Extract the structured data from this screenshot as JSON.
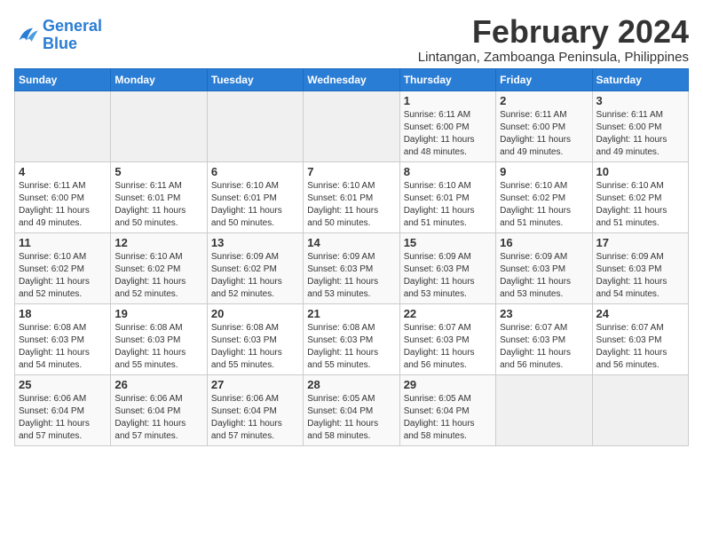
{
  "logo": {
    "text_general": "General",
    "text_blue": "Blue"
  },
  "title": {
    "month_year": "February 2024",
    "location": "Lintangan, Zamboanga Peninsula, Philippines"
  },
  "headers": [
    "Sunday",
    "Monday",
    "Tuesday",
    "Wednesday",
    "Thursday",
    "Friday",
    "Saturday"
  ],
  "weeks": [
    [
      {
        "num": "",
        "info": ""
      },
      {
        "num": "",
        "info": ""
      },
      {
        "num": "",
        "info": ""
      },
      {
        "num": "",
        "info": ""
      },
      {
        "num": "1",
        "info": "Sunrise: 6:11 AM\nSunset: 6:00 PM\nDaylight: 11 hours\nand 48 minutes."
      },
      {
        "num": "2",
        "info": "Sunrise: 6:11 AM\nSunset: 6:00 PM\nDaylight: 11 hours\nand 49 minutes."
      },
      {
        "num": "3",
        "info": "Sunrise: 6:11 AM\nSunset: 6:00 PM\nDaylight: 11 hours\nand 49 minutes."
      }
    ],
    [
      {
        "num": "4",
        "info": "Sunrise: 6:11 AM\nSunset: 6:00 PM\nDaylight: 11 hours\nand 49 minutes."
      },
      {
        "num": "5",
        "info": "Sunrise: 6:11 AM\nSunset: 6:01 PM\nDaylight: 11 hours\nand 50 minutes."
      },
      {
        "num": "6",
        "info": "Sunrise: 6:10 AM\nSunset: 6:01 PM\nDaylight: 11 hours\nand 50 minutes."
      },
      {
        "num": "7",
        "info": "Sunrise: 6:10 AM\nSunset: 6:01 PM\nDaylight: 11 hours\nand 50 minutes."
      },
      {
        "num": "8",
        "info": "Sunrise: 6:10 AM\nSunset: 6:01 PM\nDaylight: 11 hours\nand 51 minutes."
      },
      {
        "num": "9",
        "info": "Sunrise: 6:10 AM\nSunset: 6:02 PM\nDaylight: 11 hours\nand 51 minutes."
      },
      {
        "num": "10",
        "info": "Sunrise: 6:10 AM\nSunset: 6:02 PM\nDaylight: 11 hours\nand 51 minutes."
      }
    ],
    [
      {
        "num": "11",
        "info": "Sunrise: 6:10 AM\nSunset: 6:02 PM\nDaylight: 11 hours\nand 52 minutes."
      },
      {
        "num": "12",
        "info": "Sunrise: 6:10 AM\nSunset: 6:02 PM\nDaylight: 11 hours\nand 52 minutes."
      },
      {
        "num": "13",
        "info": "Sunrise: 6:09 AM\nSunset: 6:02 PM\nDaylight: 11 hours\nand 52 minutes."
      },
      {
        "num": "14",
        "info": "Sunrise: 6:09 AM\nSunset: 6:03 PM\nDaylight: 11 hours\nand 53 minutes."
      },
      {
        "num": "15",
        "info": "Sunrise: 6:09 AM\nSunset: 6:03 PM\nDaylight: 11 hours\nand 53 minutes."
      },
      {
        "num": "16",
        "info": "Sunrise: 6:09 AM\nSunset: 6:03 PM\nDaylight: 11 hours\nand 53 minutes."
      },
      {
        "num": "17",
        "info": "Sunrise: 6:09 AM\nSunset: 6:03 PM\nDaylight: 11 hours\nand 54 minutes."
      }
    ],
    [
      {
        "num": "18",
        "info": "Sunrise: 6:08 AM\nSunset: 6:03 PM\nDaylight: 11 hours\nand 54 minutes."
      },
      {
        "num": "19",
        "info": "Sunrise: 6:08 AM\nSunset: 6:03 PM\nDaylight: 11 hours\nand 55 minutes."
      },
      {
        "num": "20",
        "info": "Sunrise: 6:08 AM\nSunset: 6:03 PM\nDaylight: 11 hours\nand 55 minutes."
      },
      {
        "num": "21",
        "info": "Sunrise: 6:08 AM\nSunset: 6:03 PM\nDaylight: 11 hours\nand 55 minutes."
      },
      {
        "num": "22",
        "info": "Sunrise: 6:07 AM\nSunset: 6:03 PM\nDaylight: 11 hours\nand 56 minutes."
      },
      {
        "num": "23",
        "info": "Sunrise: 6:07 AM\nSunset: 6:03 PM\nDaylight: 11 hours\nand 56 minutes."
      },
      {
        "num": "24",
        "info": "Sunrise: 6:07 AM\nSunset: 6:03 PM\nDaylight: 11 hours\nand 56 minutes."
      }
    ],
    [
      {
        "num": "25",
        "info": "Sunrise: 6:06 AM\nSunset: 6:04 PM\nDaylight: 11 hours\nand 57 minutes."
      },
      {
        "num": "26",
        "info": "Sunrise: 6:06 AM\nSunset: 6:04 PM\nDaylight: 11 hours\nand 57 minutes."
      },
      {
        "num": "27",
        "info": "Sunrise: 6:06 AM\nSunset: 6:04 PM\nDaylight: 11 hours\nand 57 minutes."
      },
      {
        "num": "28",
        "info": "Sunrise: 6:05 AM\nSunset: 6:04 PM\nDaylight: 11 hours\nand 58 minutes."
      },
      {
        "num": "29",
        "info": "Sunrise: 6:05 AM\nSunset: 6:04 PM\nDaylight: 11 hours\nand 58 minutes."
      },
      {
        "num": "",
        "info": ""
      },
      {
        "num": "",
        "info": ""
      }
    ]
  ]
}
